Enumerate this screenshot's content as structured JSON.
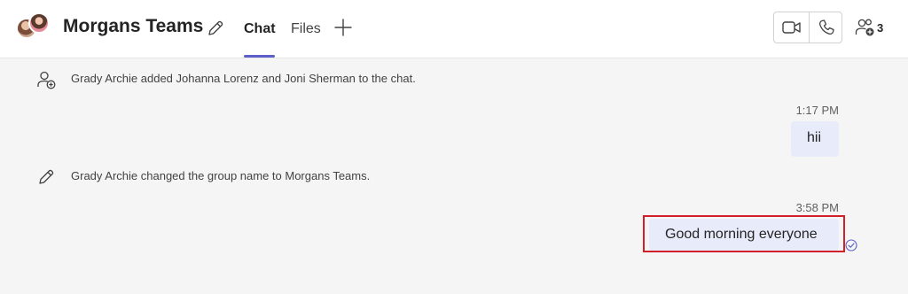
{
  "header": {
    "title": "Morgans Teams",
    "tabs": [
      {
        "label": "Chat",
        "active": true
      },
      {
        "label": "Files",
        "active": false
      }
    ],
    "participants_count": "3",
    "icons": {
      "avatar": "group-avatar",
      "edit": "pencil-icon",
      "add_tab": "plus-icon",
      "video": "video-call-icon",
      "audio": "phone-call-icon",
      "people": "people-add-icon"
    },
    "accent_color": "#5b5fc7"
  },
  "messages": [
    {
      "type": "system",
      "icon": "person-add-icon",
      "text": "Grady Archie added Johanna Lorenz and Joni Sherman to the chat."
    },
    {
      "type": "sent",
      "time": "1:17 PM",
      "text": "hii"
    },
    {
      "type": "system",
      "icon": "pencil-icon",
      "text": "Grady Archie changed the group name to Morgans Teams."
    },
    {
      "type": "sent",
      "time": "3:58 PM",
      "text": "Good morning everyone",
      "status_icon": "read-receipt-icon",
      "highlighted": true
    }
  ],
  "colors": {
    "bubble": "#e8ebfa",
    "highlight": "#d0202a",
    "background": "#f5f5f5"
  }
}
